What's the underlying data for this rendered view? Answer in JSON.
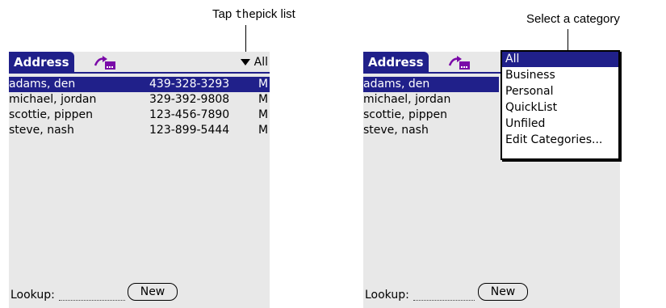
{
  "captions": {
    "left_prefix": "Tap",
    "left_mono": "the",
    "left_suffix": "pick list",
    "right": "Select a category"
  },
  "app": {
    "title": "Address",
    "current_category": "All"
  },
  "records": [
    {
      "name": "adams, den",
      "phone": "439-328-3293",
      "type": "M",
      "selected": true
    },
    {
      "name": "michael, jordan",
      "phone": "329-392-9808",
      "type": "M",
      "selected": false
    },
    {
      "name": "scottie, pippen",
      "phone": "123-456-7890",
      "type": "M",
      "selected": false
    },
    {
      "name": "steve, nash",
      "phone": "123-899-5444",
      "type": "M",
      "selected": false
    }
  ],
  "footer": {
    "lookup_label": "Lookup:",
    "new_button": "New"
  },
  "category_menu": {
    "items": [
      "All",
      "Business",
      "Personal",
      "QuickList",
      "Unfiled",
      "Edit Categories..."
    ],
    "highlighted_index": 0
  },
  "colors": {
    "accent": "#20208a",
    "screen_bg": "#e8e8e8"
  },
  "icons": {
    "beam": "beam-icon",
    "dropdown": "triangle-down-icon"
  }
}
